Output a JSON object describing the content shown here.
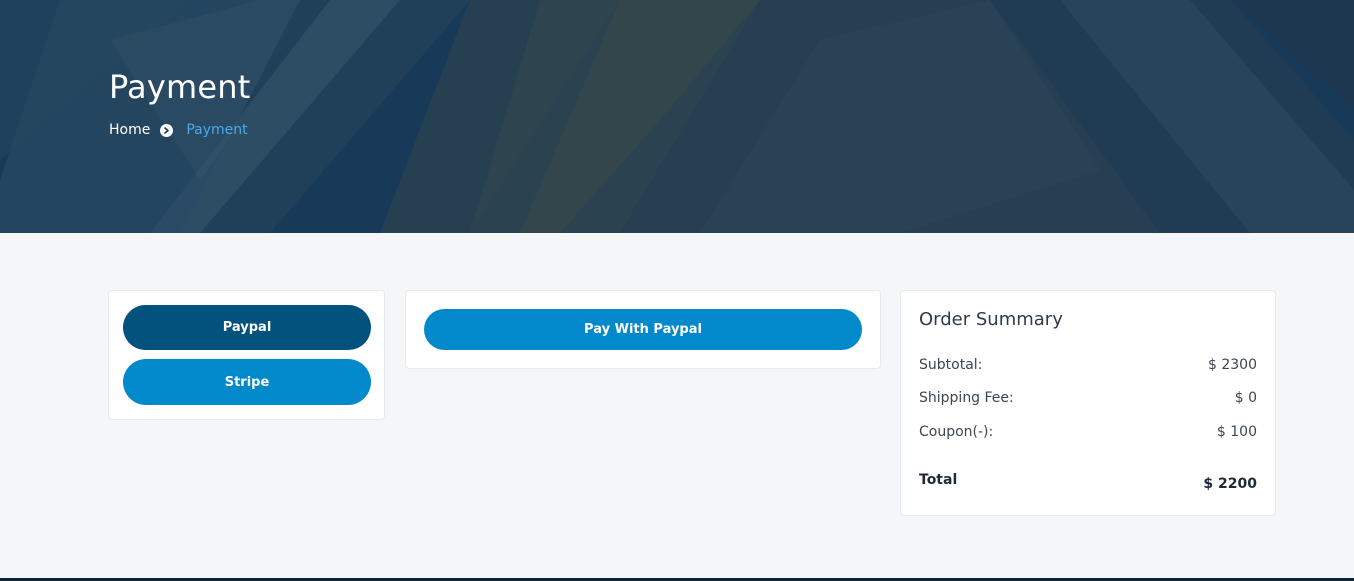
{
  "hero": {
    "title": "Payment",
    "breadcrumb": {
      "home": "Home",
      "separator_icon": "chevron-right-circle-icon",
      "current": "Payment"
    }
  },
  "payment_methods": {
    "paypal_label": "Paypal",
    "stripe_label": "Stripe",
    "selected": "Paypal"
  },
  "pay_box": {
    "button_label": "Pay With Paypal"
  },
  "order_summary": {
    "title": "Order Summary",
    "subtotal_label": "Subtotal:",
    "subtotal_value": "$ 2300",
    "shipping_label": "Shipping Fee:",
    "shipping_value": "$ 0",
    "coupon_label": "Coupon(-):",
    "coupon_value": "$ 100",
    "total_label": "Total",
    "total_value": "$ 2200"
  },
  "colors": {
    "primary_dark": "#03527e",
    "primary": "#0289cc",
    "accent_link": "#4aa9ec",
    "page_bg": "#f4f6f8"
  }
}
